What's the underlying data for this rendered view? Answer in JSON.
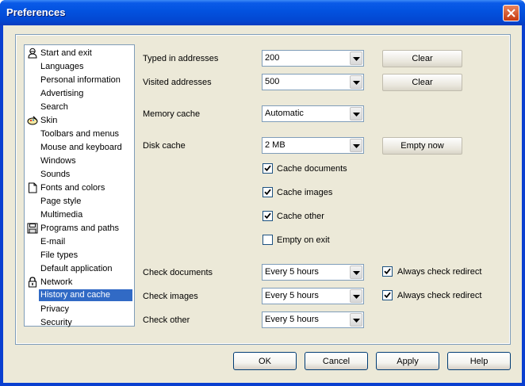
{
  "window": {
    "title": "Preferences"
  },
  "tree": {
    "items": [
      {
        "label": "Start and exit",
        "icon": "person-icon",
        "selected": false
      },
      {
        "label": "Languages",
        "icon": "",
        "selected": false
      },
      {
        "label": "Personal information",
        "icon": "",
        "selected": false
      },
      {
        "label": "Advertising",
        "icon": "",
        "selected": false
      },
      {
        "label": "Search",
        "icon": "",
        "selected": false
      },
      {
        "label": "Skin",
        "icon": "palette-icon",
        "selected": false
      },
      {
        "label": "Toolbars and menus",
        "icon": "",
        "selected": false
      },
      {
        "label": "Mouse and keyboard",
        "icon": "",
        "selected": false
      },
      {
        "label": "Windows",
        "icon": "",
        "selected": false
      },
      {
        "label": "Sounds",
        "icon": "",
        "selected": false
      },
      {
        "label": "Fonts and colors",
        "icon": "document-icon",
        "selected": false
      },
      {
        "label": "Page style",
        "icon": "",
        "selected": false
      },
      {
        "label": "Multimedia",
        "icon": "",
        "selected": false
      },
      {
        "label": "Programs and paths",
        "icon": "floppy-disk-icon",
        "selected": false
      },
      {
        "label": "E-mail",
        "icon": "",
        "selected": false
      },
      {
        "label": "File types",
        "icon": "",
        "selected": false
      },
      {
        "label": "Default application",
        "icon": "",
        "selected": false
      },
      {
        "label": "Network",
        "icon": "padlock-icon",
        "selected": false
      },
      {
        "label": "History and cache",
        "icon": "",
        "selected": true
      },
      {
        "label": "Privacy",
        "icon": "",
        "selected": false
      },
      {
        "label": "Security",
        "icon": "",
        "selected": false
      }
    ]
  },
  "history": {
    "typed_label": "Typed in addresses",
    "typed_value": "200",
    "typed_clear": "Clear",
    "visited_label": "Visited addresses",
    "visited_value": "500",
    "visited_clear": "Clear",
    "memory_label": "Memory cache",
    "memory_value": "Automatic",
    "disk_label": "Disk cache",
    "disk_value": "2 MB",
    "empty_now": "Empty now"
  },
  "cache_options": [
    {
      "label": "Cache documents",
      "checked": true
    },
    {
      "label": "Cache images",
      "checked": true
    },
    {
      "label": "Cache other",
      "checked": true
    },
    {
      "label": "Empty on exit",
      "checked": false
    }
  ],
  "checks": {
    "documents_label": "Check documents",
    "documents_value": "Every 5 hours",
    "documents_redirect": "Always check redirect",
    "documents_redirect_checked": true,
    "images_label": "Check images",
    "images_value": "Every 5 hours",
    "images_redirect": "Always check redirect",
    "images_redirect_checked": true,
    "other_label": "Check other",
    "other_value": "Every 5 hours"
  },
  "buttons": {
    "ok": "OK",
    "cancel": "Cancel",
    "apply": "Apply",
    "help": "Help"
  },
  "colors": {
    "selection": "#316ac5",
    "titlebar": "#0353e0",
    "dialog_bg": "#ece9d8"
  }
}
